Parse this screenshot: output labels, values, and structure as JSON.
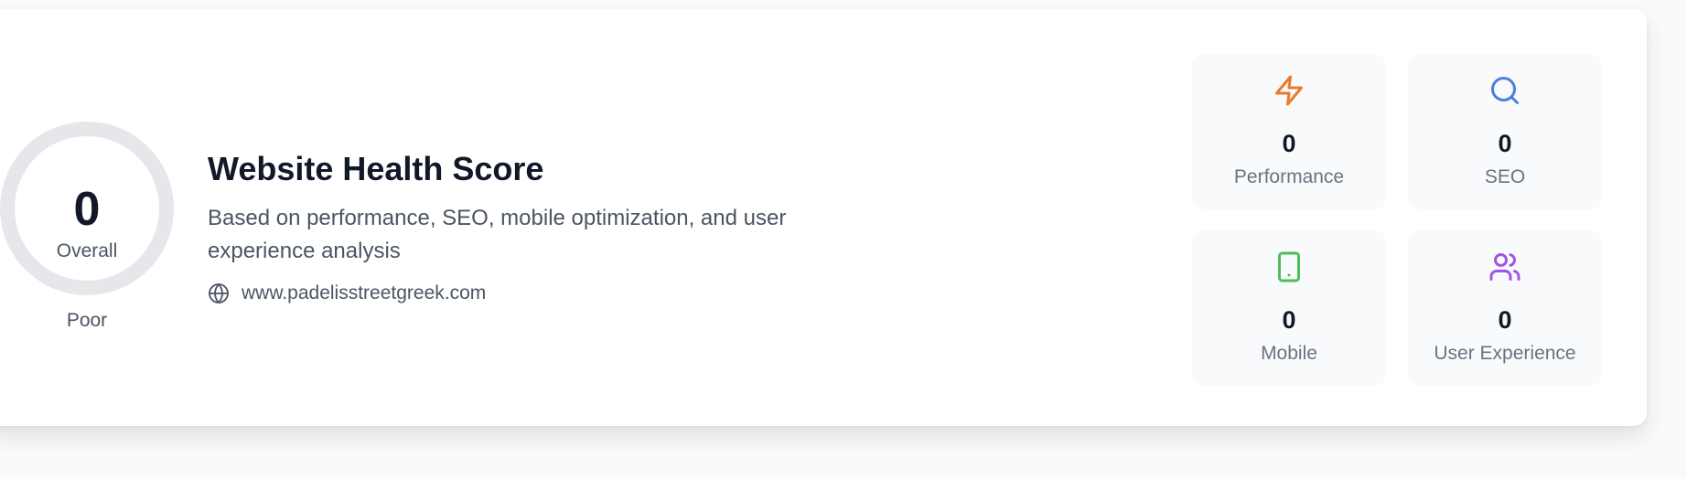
{
  "overall": {
    "score": "0",
    "label": "Overall",
    "rating": "Poor"
  },
  "header": {
    "title": "Website Health Score",
    "description": "Based on performance, SEO, mobile optimization, and user experience analysis",
    "url": "www.padelisstreetgreek.com",
    "url_icon": "globe-icon"
  },
  "metrics": [
    {
      "label": "Performance",
      "value": "0",
      "icon": "lightning-icon",
      "color": "#ea7a2c"
    },
    {
      "label": "SEO",
      "value": "0",
      "icon": "search-icon",
      "color": "#4a7fe0"
    },
    {
      "label": "Mobile",
      "value": "0",
      "icon": "smartphone-icon",
      "color": "#4cbf5a"
    },
    {
      "label": "User Experience",
      "value": "0",
      "icon": "users-icon",
      "color": "#a154e6"
    }
  ],
  "colors": {
    "ring_track": "#e5e7eb",
    "heading": "#111827",
    "muted_text": "#4b5563",
    "tile_background": "#f9fafb"
  }
}
